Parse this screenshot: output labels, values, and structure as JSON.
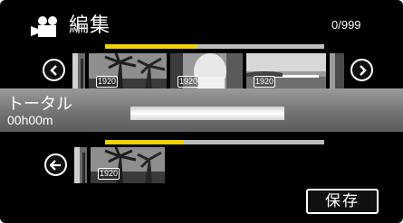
{
  "header": {
    "title": "編集",
    "counter": "0/999"
  },
  "source_strip": {
    "progress": 0.42,
    "thumbnails": [
      {
        "badge": ""
      },
      {
        "badge": "1920"
      },
      {
        "badge": "1920"
      },
      {
        "badge": "1920"
      },
      {
        "badge": ""
      }
    ]
  },
  "total": {
    "label": "トータル",
    "time": "00h00m"
  },
  "selected_strip": {
    "progress": 0.36,
    "thumbnails": [
      {
        "badge": ""
      },
      {
        "badge": "1920"
      }
    ]
  },
  "buttons": {
    "save_label": "保存"
  },
  "icons": {
    "mode": "video-camera-icon",
    "prev": "chevron-left-icon",
    "next": "chevron-right-icon",
    "back": "arrow-left-icon"
  }
}
